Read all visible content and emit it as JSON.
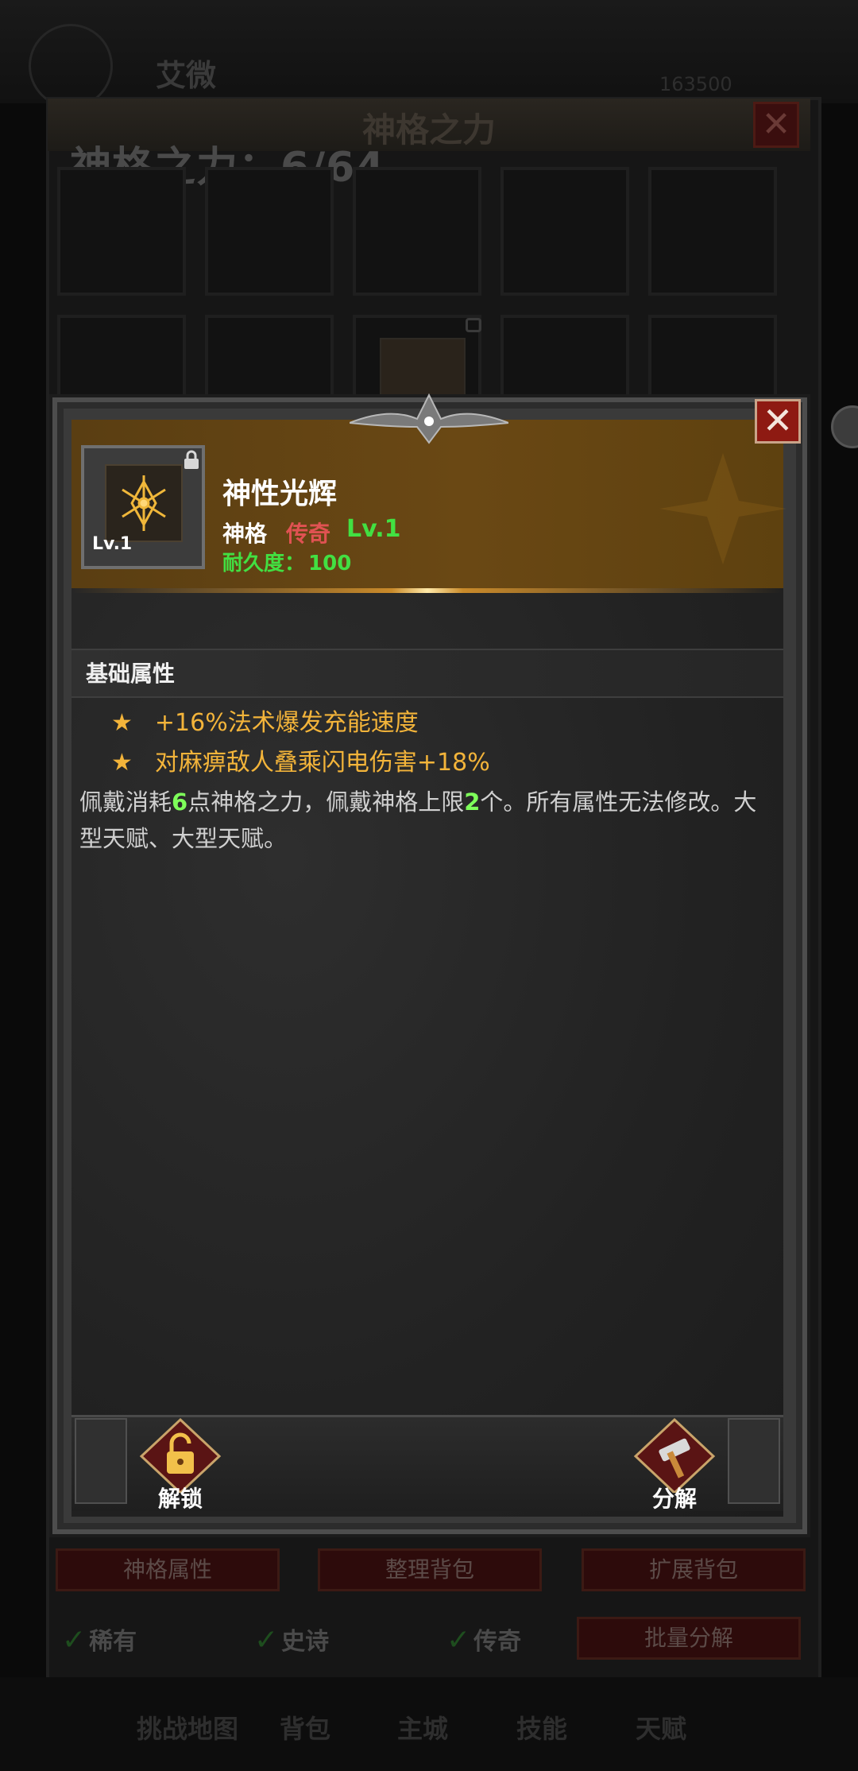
{
  "background": {
    "player_name": "艾微",
    "currency_value": "163500",
    "bag_title": "神格之力",
    "capacity_label": "神格之力：6/64",
    "buttons": [
      "神格属性",
      "整理背包",
      "扩展背包"
    ],
    "filters": [
      "稀有",
      "史诗",
      "传奇"
    ],
    "batch_button": "批量分解",
    "nav": [
      "挑战地图",
      "背包",
      "主城",
      "技能",
      "天赋"
    ]
  },
  "popup": {
    "item": {
      "name": "神性光辉",
      "type": "神格",
      "rarity": "传奇",
      "level": "Lv.1",
      "icon_level": "Lv.1",
      "durability_label": "耐久度：",
      "durability_value": "100",
      "icon": "rune-sigil-icon",
      "locked": true
    },
    "section_title": "基础属性",
    "attributes": [
      "+16%法术爆发充能速度",
      "对麻痹敌人叠乘闪电伤害+18%"
    ],
    "description": {
      "p1": "佩戴消耗",
      "n1": "6",
      "p2": "点神格之力，佩戴神格上限",
      "n2": "2",
      "p3": "个。所有属性无法修改。大型天赋、大型天赋。"
    },
    "actions": {
      "unlock_label": "解锁",
      "decompose_label": "分解"
    }
  },
  "colors": {
    "rarity_legendary": "#e05252",
    "level_green": "#42e042",
    "attribute_gold": "#f3b43a",
    "highlight_green": "#7eff5a",
    "header_bronze": "#6a4814",
    "close_red": "#8e1a12"
  }
}
